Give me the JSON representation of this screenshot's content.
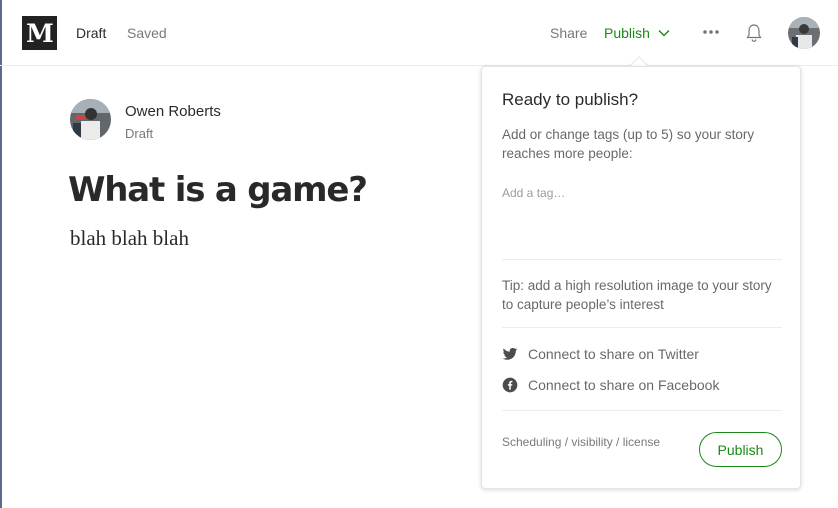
{
  "header": {
    "logo_text": "M",
    "status_draft": "Draft",
    "status_saved": "Saved",
    "share_label": "Share",
    "publish_label": "Publish",
    "icons": [
      "chevron-down-icon",
      "more-icon",
      "bell-icon",
      "avatar"
    ]
  },
  "author": {
    "name": "Owen Roberts",
    "status": "Draft"
  },
  "story": {
    "title": "What is a game?",
    "body": "blah blah blah"
  },
  "publish_popover": {
    "heading": "Ready to publish?",
    "tags_description": "Add or change tags (up to 5) so your story reaches more people:",
    "tag_input_value": "",
    "tag_input_placeholder": "Add a tag…",
    "tip": "Tip: add a high resolution image to your story to capture people’s interest",
    "connect_twitter": "Connect to share on Twitter",
    "connect_facebook": "Connect to share on Facebook",
    "scheduling_label": "Scheduling / visibility / license",
    "publish_button_label": "Publish"
  },
  "colors": {
    "accent_green": "#1a8917",
    "text_primary": "rgba(0,0,0,0.84)",
    "text_muted": "rgba(0,0,0,0.54)"
  }
}
